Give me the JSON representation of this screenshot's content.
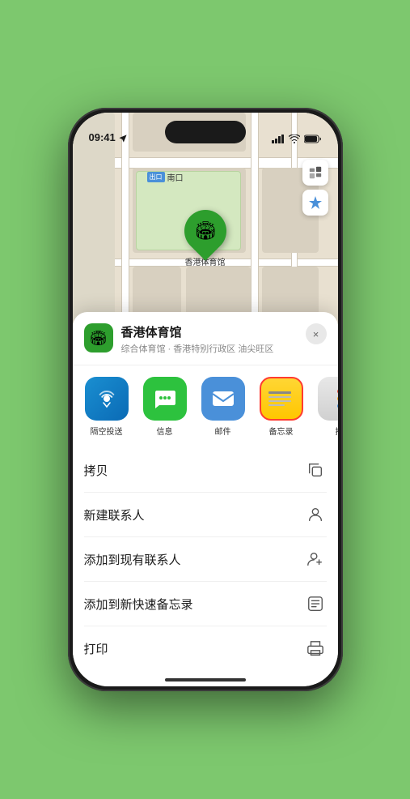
{
  "status_bar": {
    "time": "09:41",
    "location_arrow": true
  },
  "map": {
    "label_tag": "出口",
    "label_text": "南口",
    "pin_label": "香港体育馆"
  },
  "map_controls": {
    "map_icon": "🗺",
    "location_icon": "➤"
  },
  "location_header": {
    "name": "香港体育馆",
    "description": "综合体育馆 · 香港特别行政区 油尖旺区",
    "close": "×"
  },
  "share_items": [
    {
      "id": "airdrop",
      "label": "隔空投送",
      "type": "airdrop"
    },
    {
      "id": "messages",
      "label": "信息",
      "type": "messages"
    },
    {
      "id": "mail",
      "label": "邮件",
      "type": "mail"
    },
    {
      "id": "notes",
      "label": "备忘录",
      "type": "notes",
      "selected": true
    },
    {
      "id": "more",
      "label": "推",
      "type": "more"
    }
  ],
  "action_items": [
    {
      "id": "copy",
      "label": "拷贝",
      "icon": "copy"
    },
    {
      "id": "new-contact",
      "label": "新建联系人",
      "icon": "person"
    },
    {
      "id": "add-contact",
      "label": "添加到现有联系人",
      "icon": "person-add"
    },
    {
      "id": "quick-note",
      "label": "添加到新快速备忘录",
      "icon": "note"
    },
    {
      "id": "print",
      "label": "打印",
      "icon": "print"
    }
  ]
}
